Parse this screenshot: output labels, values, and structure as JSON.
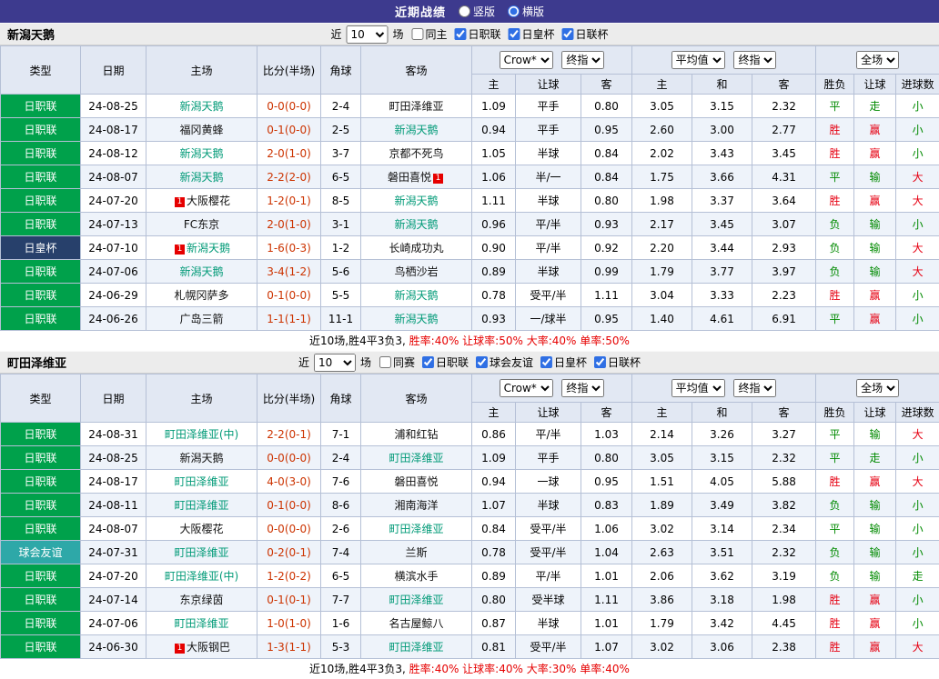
{
  "topbar": {
    "title": "近期战绩",
    "vertical_label": "竖版",
    "horizontal_label": "横版",
    "selected": "横版"
  },
  "colors": {
    "topbar_bg": "#3d3a8e",
    "league_green": "#00a14b",
    "league_navy": "#27406b",
    "league_teal": "#2ea8a8",
    "team_highlight": "#009a77",
    "score_red": "#cc3300",
    "result_win": "#e60012",
    "result_other": "#008a00"
  },
  "sections": [
    {
      "team": "新潟天鹅",
      "filter": {
        "near_label": "近",
        "count": "10",
        "games_label": "场",
        "checkboxes": [
          {
            "label": "同主",
            "checked": false
          },
          {
            "label": "日职联",
            "checked": true
          },
          {
            "label": "日皇杯",
            "checked": true
          },
          {
            "label": "日联杯",
            "checked": true
          }
        ]
      },
      "header": {
        "cols": [
          "类型",
          "日期",
          "主场",
          "比分(半场)",
          "角球",
          "客场"
        ],
        "select_bookmaker": "Crow*",
        "select_final1": "终指",
        "select_avg": "平均值",
        "select_final2": "终指",
        "select_scope": "全场",
        "sub": [
          "主",
          "让球",
          "客",
          "主",
          "和",
          "客",
          "胜负",
          "让球",
          "进球数"
        ]
      },
      "rows": [
        {
          "league": "日职联",
          "lc": "green",
          "date": "24-08-25",
          "home": {
            "name": "新潟天鹅",
            "hl": true
          },
          "score": "0-0(0-0)",
          "corner": "2-4",
          "away": {
            "name": "町田泽维亚",
            "hl": false
          },
          "asia": [
            "1.09",
            "平手",
            "0.80"
          ],
          "euro": [
            "3.05",
            "3.15",
            "2.32"
          ],
          "res": [
            {
              "t": "平",
              "c": "g"
            },
            {
              "t": "走",
              "c": "g"
            },
            {
              "t": "小",
              "c": "g"
            }
          ]
        },
        {
          "league": "日职联",
          "lc": "green",
          "date": "24-08-17",
          "home": {
            "name": "福冈黄蜂",
            "hl": false
          },
          "score": "0-1(0-0)",
          "corner": "2-5",
          "away": {
            "name": "新潟天鹅",
            "hl": true
          },
          "asia": [
            "0.94",
            "平手",
            "0.95"
          ],
          "euro": [
            "2.60",
            "3.00",
            "2.77"
          ],
          "res": [
            {
              "t": "胜",
              "c": "r"
            },
            {
              "t": "赢",
              "c": "r"
            },
            {
              "t": "小",
              "c": "g"
            }
          ]
        },
        {
          "league": "日职联",
          "lc": "green",
          "date": "24-08-12",
          "home": {
            "name": "新潟天鹅",
            "hl": true
          },
          "score": "2-0(1-0)",
          "corner": "3-7",
          "away": {
            "name": "京都不死鸟",
            "hl": false
          },
          "asia": [
            "1.05",
            "半球",
            "0.84"
          ],
          "euro": [
            "2.02",
            "3.43",
            "3.45"
          ],
          "res": [
            {
              "t": "胜",
              "c": "r"
            },
            {
              "t": "赢",
              "c": "r"
            },
            {
              "t": "小",
              "c": "g"
            }
          ]
        },
        {
          "league": "日职联",
          "lc": "green",
          "date": "24-08-07",
          "home": {
            "name": "新潟天鹅",
            "hl": true
          },
          "score": "2-2(2-0)",
          "corner": "6-5",
          "away": {
            "name": "磐田喜悦",
            "hl": false,
            "badge_post": "1"
          },
          "asia": [
            "1.06",
            "半/一",
            "0.84"
          ],
          "euro": [
            "1.75",
            "3.66",
            "4.31"
          ],
          "res": [
            {
              "t": "平",
              "c": "g"
            },
            {
              "t": "输",
              "c": "g"
            },
            {
              "t": "大",
              "c": "r"
            }
          ]
        },
        {
          "league": "日职联",
          "lc": "green",
          "date": "24-07-20",
          "home": {
            "name": "大阪樱花",
            "hl": false,
            "badge_pre": "1"
          },
          "score": "1-2(0-1)",
          "corner": "8-5",
          "away": {
            "name": "新潟天鹅",
            "hl": true
          },
          "asia": [
            "1.11",
            "半球",
            "0.80"
          ],
          "euro": [
            "1.98",
            "3.37",
            "3.64"
          ],
          "res": [
            {
              "t": "胜",
              "c": "r"
            },
            {
              "t": "赢",
              "c": "r"
            },
            {
              "t": "大",
              "c": "r"
            }
          ]
        },
        {
          "league": "日职联",
          "lc": "green",
          "date": "24-07-13",
          "home": {
            "name": "FC东京",
            "hl": false
          },
          "score": "2-0(1-0)",
          "corner": "3-1",
          "away": {
            "name": "新潟天鹅",
            "hl": true
          },
          "asia": [
            "0.96",
            "平/半",
            "0.93"
          ],
          "euro": [
            "2.17",
            "3.45",
            "3.07"
          ],
          "res": [
            {
              "t": "负",
              "c": "g"
            },
            {
              "t": "输",
              "c": "g"
            },
            {
              "t": "小",
              "c": "g"
            }
          ]
        },
        {
          "league": "日皇杯",
          "lc": "navy",
          "date": "24-07-10",
          "home": {
            "name": "新潟天鹅",
            "hl": true,
            "badge_pre": "1"
          },
          "score": "1-6(0-3)",
          "corner": "1-2",
          "away": {
            "name": "长崎成功丸",
            "hl": false
          },
          "asia": [
            "0.90",
            "平/半",
            "0.92"
          ],
          "euro": [
            "2.20",
            "3.44",
            "2.93"
          ],
          "res": [
            {
              "t": "负",
              "c": "g"
            },
            {
              "t": "输",
              "c": "g"
            },
            {
              "t": "大",
              "c": "r"
            }
          ]
        },
        {
          "league": "日职联",
          "lc": "green",
          "date": "24-07-06",
          "home": {
            "name": "新潟天鹅",
            "hl": true
          },
          "score": "3-4(1-2)",
          "corner": "5-6",
          "away": {
            "name": "鸟栖沙岩",
            "hl": false
          },
          "asia": [
            "0.89",
            "半球",
            "0.99"
          ],
          "euro": [
            "1.79",
            "3.77",
            "3.97"
          ],
          "res": [
            {
              "t": "负",
              "c": "g"
            },
            {
              "t": "输",
              "c": "g"
            },
            {
              "t": "大",
              "c": "r"
            }
          ]
        },
        {
          "league": "日职联",
          "lc": "green",
          "date": "24-06-29",
          "home": {
            "name": "札幌冈萨多",
            "hl": false
          },
          "score": "0-1(0-0)",
          "corner": "5-5",
          "away": {
            "name": "新潟天鹅",
            "hl": true
          },
          "asia": [
            "0.78",
            "受平/半",
            "1.11"
          ],
          "euro": [
            "3.04",
            "3.33",
            "2.23"
          ],
          "res": [
            {
              "t": "胜",
              "c": "r"
            },
            {
              "t": "赢",
              "c": "r"
            },
            {
              "t": "小",
              "c": "g"
            }
          ]
        },
        {
          "league": "日职联",
          "lc": "green",
          "date": "24-06-26",
          "home": {
            "name": "广岛三箭",
            "hl": false
          },
          "score": "1-1(1-1)",
          "corner": "11-1",
          "away": {
            "name": "新潟天鹅",
            "hl": true
          },
          "asia": [
            "0.93",
            "一/球半",
            "0.95"
          ],
          "euro": [
            "1.40",
            "4.61",
            "6.91"
          ],
          "res": [
            {
              "t": "平",
              "c": "g"
            },
            {
              "t": "赢",
              "c": "r"
            },
            {
              "t": "小",
              "c": "g"
            }
          ]
        }
      ],
      "summary": {
        "prefix": "近10场,胜4平3负3, ",
        "stats": "胜率:40% 让球率:50% 大率:40% 单率:50%"
      }
    },
    {
      "team": "町田泽维亚",
      "filter": {
        "near_label": "近",
        "count": "10",
        "games_label": "场",
        "checkboxes": [
          {
            "label": "同赛",
            "checked": false
          },
          {
            "label": "日职联",
            "checked": true
          },
          {
            "label": "球会友谊",
            "checked": true
          },
          {
            "label": "日皇杯",
            "checked": true
          },
          {
            "label": "日联杯",
            "checked": true
          }
        ]
      },
      "header": {
        "cols": [
          "类型",
          "日期",
          "主场",
          "比分(半场)",
          "角球",
          "客场"
        ],
        "select_bookmaker": "Crow*",
        "select_final1": "终指",
        "select_avg": "平均值",
        "select_final2": "终指",
        "select_scope": "全场",
        "sub": [
          "主",
          "让球",
          "客",
          "主",
          "和",
          "客",
          "胜负",
          "让球",
          "进球数"
        ]
      },
      "rows": [
        {
          "league": "日职联",
          "lc": "green",
          "date": "24-08-31",
          "home": {
            "name": "町田泽维亚(中)",
            "hl": true
          },
          "score": "2-2(0-1)",
          "corner": "7-1",
          "away": {
            "name": "浦和红钻",
            "hl": false
          },
          "asia": [
            "0.86",
            "平/半",
            "1.03"
          ],
          "euro": [
            "2.14",
            "3.26",
            "3.27"
          ],
          "res": [
            {
              "t": "平",
              "c": "g"
            },
            {
              "t": "输",
              "c": "g"
            },
            {
              "t": "大",
              "c": "r"
            }
          ]
        },
        {
          "league": "日职联",
          "lc": "green",
          "date": "24-08-25",
          "home": {
            "name": "新潟天鹅",
            "hl": false
          },
          "score": "0-0(0-0)",
          "corner": "2-4",
          "away": {
            "name": "町田泽维亚",
            "hl": true
          },
          "asia": [
            "1.09",
            "平手",
            "0.80"
          ],
          "euro": [
            "3.05",
            "3.15",
            "2.32"
          ],
          "res": [
            {
              "t": "平",
              "c": "g"
            },
            {
              "t": "走",
              "c": "g"
            },
            {
              "t": "小",
              "c": "g"
            }
          ]
        },
        {
          "league": "日职联",
          "lc": "green",
          "date": "24-08-17",
          "home": {
            "name": "町田泽维亚",
            "hl": true
          },
          "score": "4-0(3-0)",
          "corner": "7-6",
          "away": {
            "name": "磐田喜悦",
            "hl": false
          },
          "asia": [
            "0.94",
            "一球",
            "0.95"
          ],
          "euro": [
            "1.51",
            "4.05",
            "5.88"
          ],
          "res": [
            {
              "t": "胜",
              "c": "r"
            },
            {
              "t": "赢",
              "c": "r"
            },
            {
              "t": "大",
              "c": "r"
            }
          ]
        },
        {
          "league": "日职联",
          "lc": "green",
          "date": "24-08-11",
          "home": {
            "name": "町田泽维亚",
            "hl": true
          },
          "score": "0-1(0-0)",
          "corner": "8-6",
          "away": {
            "name": "湘南海洋",
            "hl": false
          },
          "asia": [
            "1.07",
            "半球",
            "0.83"
          ],
          "euro": [
            "1.89",
            "3.49",
            "3.82"
          ],
          "res": [
            {
              "t": "负",
              "c": "g"
            },
            {
              "t": "输",
              "c": "g"
            },
            {
              "t": "小",
              "c": "g"
            }
          ]
        },
        {
          "league": "日职联",
          "lc": "green",
          "date": "24-08-07",
          "home": {
            "name": "大阪樱花",
            "hl": false
          },
          "score": "0-0(0-0)",
          "corner": "2-6",
          "away": {
            "name": "町田泽维亚",
            "hl": true
          },
          "asia": [
            "0.84",
            "受平/半",
            "1.06"
          ],
          "euro": [
            "3.02",
            "3.14",
            "2.34"
          ],
          "res": [
            {
              "t": "平",
              "c": "g"
            },
            {
              "t": "输",
              "c": "g"
            },
            {
              "t": "小",
              "c": "g"
            }
          ]
        },
        {
          "league": "球会友谊",
          "lc": "teal",
          "date": "24-07-31",
          "home": {
            "name": "町田泽维亚",
            "hl": true
          },
          "score": "0-2(0-1)",
          "corner": "7-4",
          "away": {
            "name": "兰斯",
            "hl": false
          },
          "asia": [
            "0.78",
            "受平/半",
            "1.04"
          ],
          "euro": [
            "2.63",
            "3.51",
            "2.32"
          ],
          "res": [
            {
              "t": "负",
              "c": "g"
            },
            {
              "t": "输",
              "c": "g"
            },
            {
              "t": "小",
              "c": "g"
            }
          ]
        },
        {
          "league": "日职联",
          "lc": "green",
          "date": "24-07-20",
          "home": {
            "name": "町田泽维亚(中)",
            "hl": true
          },
          "score": "1-2(0-2)",
          "corner": "6-5",
          "away": {
            "name": "横滨水手",
            "hl": false
          },
          "asia": [
            "0.89",
            "平/半",
            "1.01"
          ],
          "euro": [
            "2.06",
            "3.62",
            "3.19"
          ],
          "res": [
            {
              "t": "负",
              "c": "g"
            },
            {
              "t": "输",
              "c": "g"
            },
            {
              "t": "走",
              "c": "g"
            }
          ]
        },
        {
          "league": "日职联",
          "lc": "green",
          "date": "24-07-14",
          "home": {
            "name": "东京绿茵",
            "hl": false
          },
          "score": "0-1(0-1)",
          "corner": "7-7",
          "away": {
            "name": "町田泽维亚",
            "hl": true
          },
          "asia": [
            "0.80",
            "受半球",
            "1.11"
          ],
          "euro": [
            "3.86",
            "3.18",
            "1.98"
          ],
          "res": [
            {
              "t": "胜",
              "c": "r"
            },
            {
              "t": "赢",
              "c": "r"
            },
            {
              "t": "小",
              "c": "g"
            }
          ]
        },
        {
          "league": "日职联",
          "lc": "green",
          "date": "24-07-06",
          "home": {
            "name": "町田泽维亚",
            "hl": true
          },
          "score": "1-0(1-0)",
          "corner": "1-6",
          "away": {
            "name": "名古屋鲸八",
            "hl": false
          },
          "asia": [
            "0.87",
            "半球",
            "1.01"
          ],
          "euro": [
            "1.79",
            "3.42",
            "4.45"
          ],
          "res": [
            {
              "t": "胜",
              "c": "r"
            },
            {
              "t": "赢",
              "c": "r"
            },
            {
              "t": "小",
              "c": "g"
            }
          ]
        },
        {
          "league": "日职联",
          "lc": "green",
          "date": "24-06-30",
          "home": {
            "name": "大阪钢巴",
            "hl": false,
            "badge_pre": "1"
          },
          "score": "1-3(1-1)",
          "corner": "5-3",
          "away": {
            "name": "町田泽维亚",
            "hl": true
          },
          "asia": [
            "0.81",
            "受平/半",
            "1.07"
          ],
          "euro": [
            "3.02",
            "3.06",
            "2.38"
          ],
          "res": [
            {
              "t": "胜",
              "c": "r"
            },
            {
              "t": "赢",
              "c": "r"
            },
            {
              "t": "大",
              "c": "r"
            }
          ]
        }
      ],
      "summary": {
        "prefix": "近10场,胜4平3负3, ",
        "stats": "胜率:40% 让球率:40% 大率:30% 单率:40%"
      }
    }
  ]
}
